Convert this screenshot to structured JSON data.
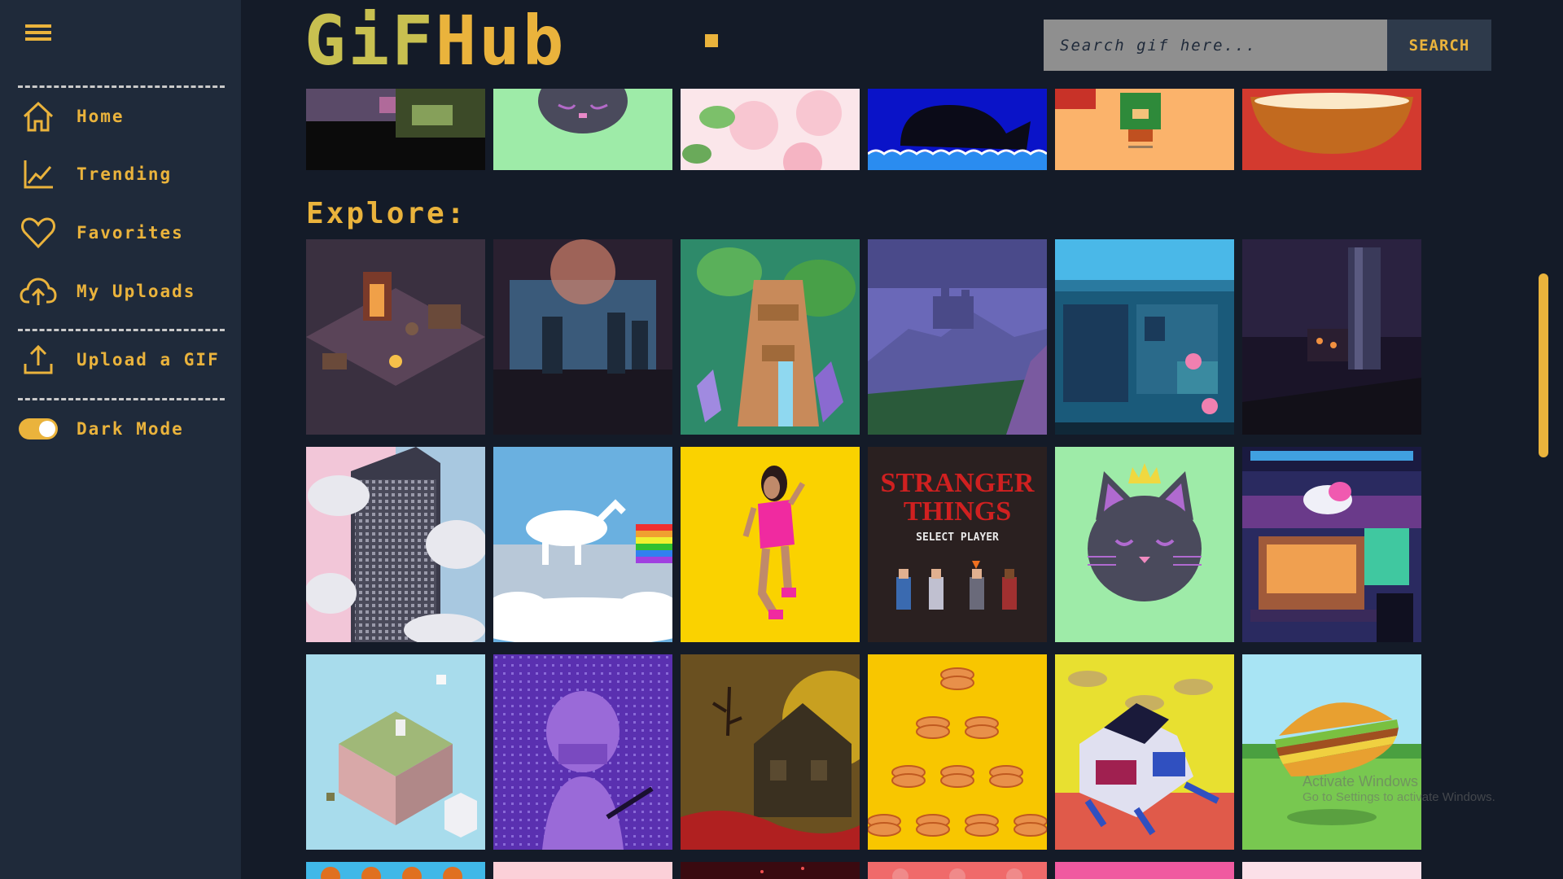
{
  "app": {
    "logo_text_part1": "GiF",
    "logo_text_part2": "Hub"
  },
  "search": {
    "placeholder": "Search gif here...",
    "button_label": "SEARCH"
  },
  "sidebar": {
    "items": [
      {
        "label": "Home",
        "icon": "home-icon"
      },
      {
        "label": "Trending",
        "icon": "trending-chart-icon"
      },
      {
        "label": "Favorites",
        "icon": "heart-icon"
      },
      {
        "label": "My Uploads",
        "icon": "cloud-upload-icon"
      },
      {
        "label": "Upload a GIF",
        "icon": "upload-arrow-icon"
      }
    ],
    "dark_mode_label": "Dark Mode",
    "dark_mode_on": true
  },
  "main": {
    "section_title": "Explore:"
  },
  "gifs": {
    "top_row": [
      "pixel-forest",
      "pixel-cat-green",
      "cherry-blossoms",
      "pixel-whale",
      "pixel-mario",
      "pixel-bowl"
    ],
    "explore": [
      "isometric-tavern",
      "neon-bar",
      "jungle-tower",
      "mountain-castle",
      "fish-shop",
      "dark-waterfall",
      "pixel-skyscraper",
      "rainbow-unicorn",
      "dancing-girl",
      "stranger-things",
      "pixel-cat-crown",
      "cyber-street",
      "floating-island",
      "purple-girl",
      "haunted-house",
      "pancake-tower",
      "mech-robot",
      "pixel-burger",
      "pumpkins",
      "pink-tile",
      "dark-red-tile",
      "coral-tile",
      "pink-tile-2",
      "light-pink-tile"
    ],
    "stranger_title_1": "STRANGER",
    "stranger_title_2": "THINGS",
    "stranger_subtitle": "SELECT PLAYER"
  },
  "colors": {
    "accent": "#eab33c",
    "sidebar_bg": "#1f2a3a",
    "page_bg": "#141b28"
  },
  "watermark": {
    "line1": "Activate Windows",
    "line2": "Go to Settings to activate Windows."
  }
}
